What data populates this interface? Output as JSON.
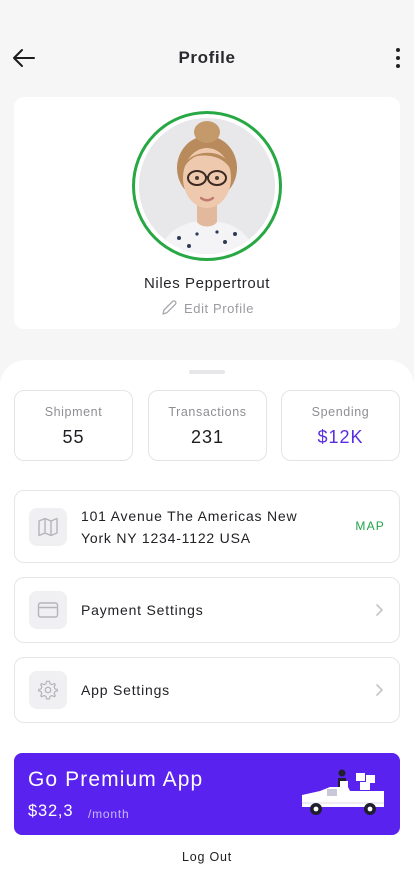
{
  "header": {
    "title": "Profile",
    "back_icon": "arrow-left-icon",
    "more_icon": "more-vertical-icon"
  },
  "profile": {
    "name": "Niles Peppertrout",
    "edit_label": "Edit Profile",
    "ring_color": "#27a844"
  },
  "stats": [
    {
      "label": "Shipment",
      "value": "55"
    },
    {
      "label": "Transactions",
      "value": "231"
    },
    {
      "label": "Spending",
      "value": "$12K"
    }
  ],
  "address": {
    "text": "101 Avenue The Americas New York NY 1234-1122 USA",
    "map_label": "MAP"
  },
  "menu": [
    {
      "label": "Payment Settings",
      "icon": "card-icon"
    },
    {
      "label": "App Settings",
      "icon": "gear-icon"
    }
  ],
  "premium": {
    "title": "Go Premium App",
    "price": "$32,3",
    "unit": "/month",
    "color": "#5a22ef"
  },
  "logout_label": "Log Out",
  "colors": {
    "accent": "#5b2ee0",
    "success": "#22a44a"
  }
}
